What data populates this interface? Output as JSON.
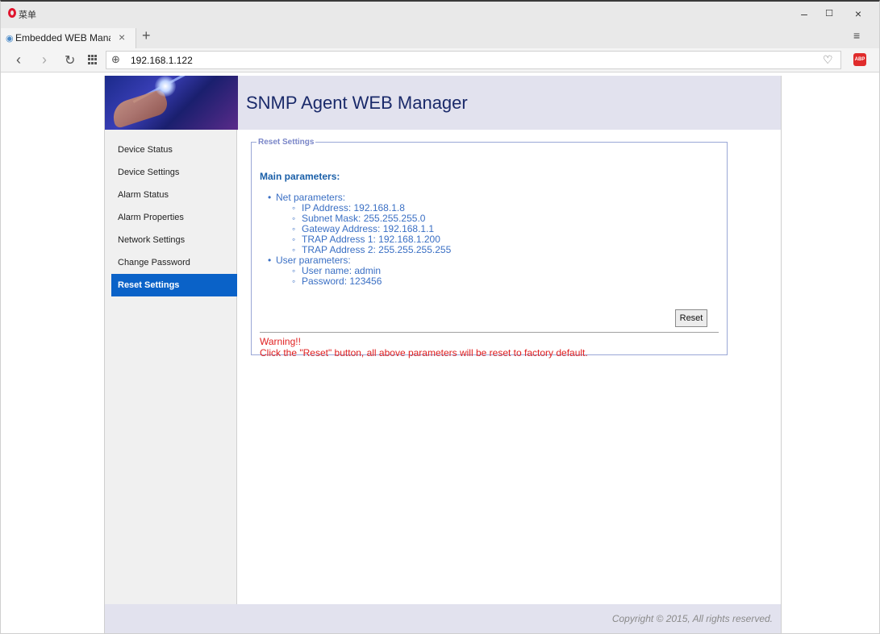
{
  "browser": {
    "menu_label": "菜单",
    "tab_title": "Embedded WEB Manage",
    "tab_close": "×",
    "new_tab": "+",
    "url": "192.168.1.122",
    "icons": {
      "back": "back-arrow-icon",
      "forward": "forward-arrow-icon",
      "reload": "reload-icon",
      "speed_dial": "grid-icon",
      "site_info": "globe-icon",
      "bookmark": "heart-icon",
      "adblock": "abp-icon"
    },
    "window_controls": [
      "–",
      "☐",
      "×"
    ]
  },
  "header": {
    "title": "SNMP Agent WEB Manager"
  },
  "sidebar": {
    "items": [
      {
        "label": "Device Status",
        "active": false
      },
      {
        "label": "Device Settings",
        "active": false
      },
      {
        "label": "Alarm Status",
        "active": false
      },
      {
        "label": "Alarm Properties",
        "active": false
      },
      {
        "label": "Network Settings",
        "active": false
      },
      {
        "label": "Change Password",
        "active": false
      },
      {
        "label": "Reset Settings",
        "active": true
      }
    ]
  },
  "reset_panel": {
    "legend": "Reset Settings",
    "heading": "Main parameters:",
    "net_group": "Net parameters:",
    "net_items": [
      "IP Address: 192.168.1.8",
      "Subnet Mask: 255.255.255.0",
      "Gateway Address: 192.168.1.1",
      "TRAP Address 1: 192.168.1.200",
      "TRAP Address 2: 255.255.255.255"
    ],
    "user_group": "User parameters:",
    "user_items": [
      "User name: admin",
      "Password: 123456"
    ],
    "reset_button": "Reset",
    "warning_title": "Warning!!",
    "warning_message": "Click the \"Reset\" button, all above parameters will be reset to factory default."
  },
  "footer": {
    "copyright": "Copyright © 2015, All rights reserved."
  },
  "colors": {
    "accent_active": "#0a62c8",
    "header_bg": "#e2e2ee",
    "title_text": "#1a2a6a",
    "param_text": "#3a6fc4",
    "warning_text": "#e02020"
  }
}
